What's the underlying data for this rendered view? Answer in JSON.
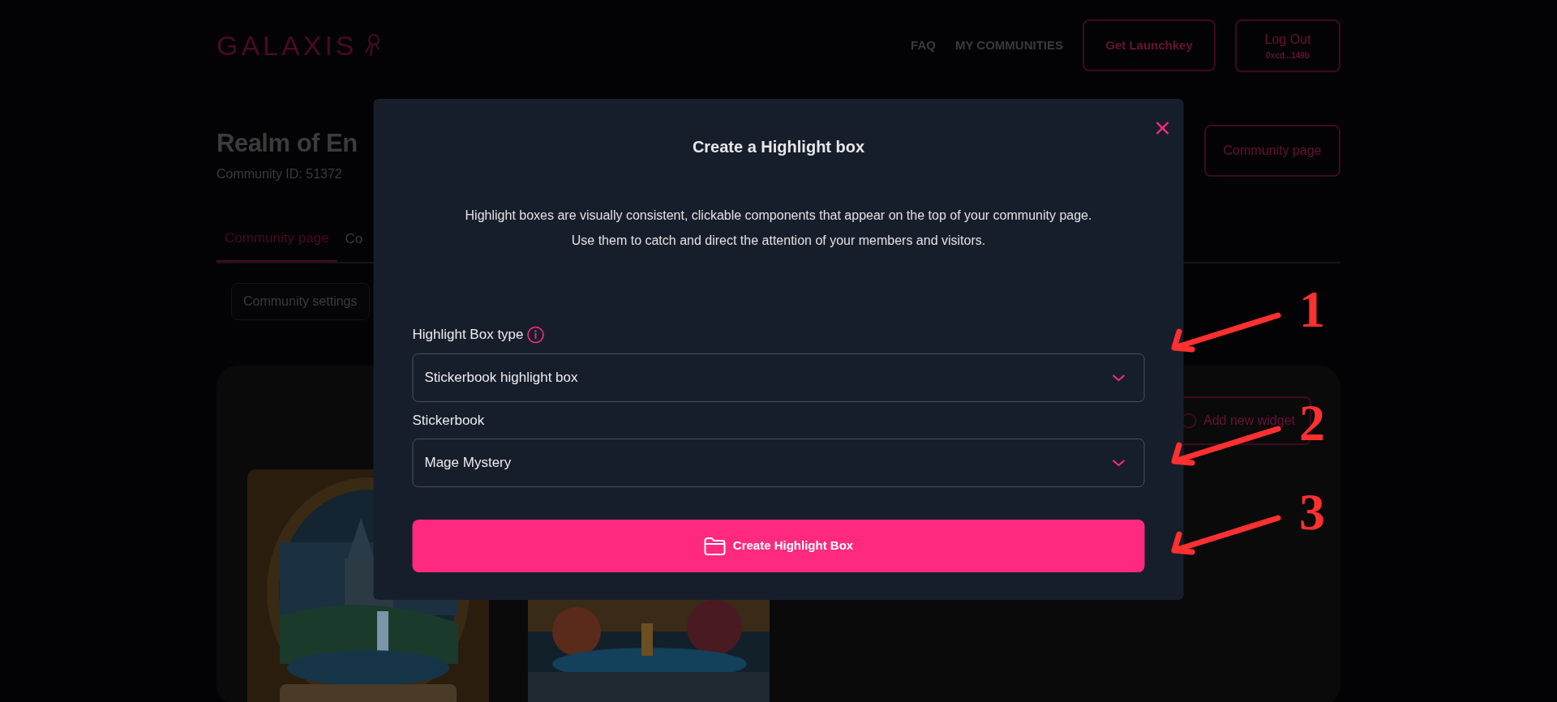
{
  "header": {
    "logo": "GALAXIS",
    "nav": [
      {
        "label": "FAQ"
      },
      {
        "label": "MY COMMUNITIES"
      }
    ],
    "launch_button": "Get Launchkey",
    "logout_button": {
      "label": "Log Out",
      "address": "0xcd...149b"
    }
  },
  "community": {
    "title": "Realm of En",
    "id_text": "Community ID: 51372",
    "page_button": "Community page"
  },
  "tabs": [
    {
      "label": "Community page",
      "selected": true
    },
    {
      "label": "Co",
      "selected": false
    }
  ],
  "settings_button": "Community settings",
  "add_widget_button": "Add new widget",
  "modal": {
    "title": "Create a Highlight box",
    "description": [
      "Highlight boxes are visually consistent, clickable components that appear on the top of your community page.",
      "Use them to catch and direct the attention of your members and visitors."
    ],
    "fields": [
      {
        "label": "Highlight Box type",
        "info": true,
        "value": "Stickerbook highlight box"
      },
      {
        "label": "Stickerbook",
        "info": false,
        "value": "Mage Mystery"
      }
    ],
    "submit": "Create Highlight Box"
  },
  "annotations": [
    {
      "number": "1"
    },
    {
      "number": "2"
    },
    {
      "number": "3"
    }
  ]
}
